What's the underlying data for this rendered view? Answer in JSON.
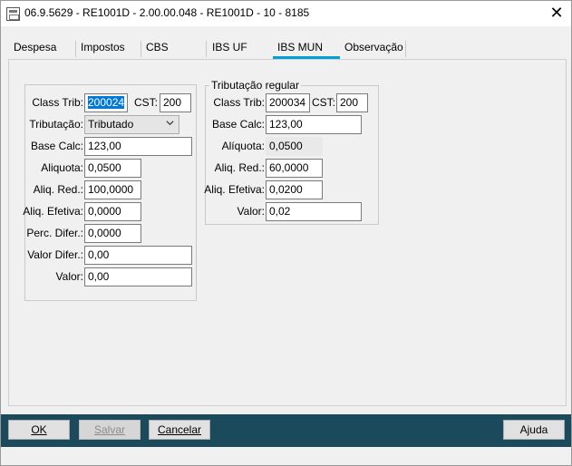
{
  "window": {
    "title": "06.9.5629 - RE1001D - 2.00.00.048 - RE1001D - 10 - 8185",
    "close_symbol": "✕"
  },
  "tabs": [
    {
      "label": "Despesa"
    },
    {
      "label": "Impostos"
    },
    {
      "label": "CBS"
    },
    {
      "label": "IBS UF"
    },
    {
      "label": "IBS MUN",
      "active": true
    },
    {
      "label": "Observação"
    }
  ],
  "left_group": {
    "class_trib_label": "Class Trib:",
    "class_trib_value": "200024",
    "cst_label": "CST:",
    "cst_value": "200",
    "tributacao_label": "Tributação:",
    "tributacao_value": "Tributado",
    "base_calc_label": "Base Calc:",
    "base_calc_value": "123,00",
    "aliquota_label": "Aliquota:",
    "aliquota_value": "0,0500",
    "aliq_red_label": "Aliq. Red.:",
    "aliq_red_value": "100,0000",
    "aliq_efetiva_label": "Aliq. Efetiva:",
    "aliq_efetiva_value": "0,0000",
    "perc_difer_label": "Perc. Difer.:",
    "perc_difer_value": "0,0000",
    "valor_difer_label": "Valor Difer.:",
    "valor_difer_value": "0,00",
    "valor_label": "Valor:",
    "valor_value": "0,00"
  },
  "right_group": {
    "legend": "Tributação regular",
    "class_trib_label": "Class Trib:",
    "class_trib_value": "200034",
    "cst_label": "CST:",
    "cst_value": "200",
    "base_calc_label": "Base Calc:",
    "base_calc_value": "123,00",
    "aliquota_label": "Alíquota:",
    "aliquota_value": "0,0500",
    "aliq_red_label": "Aliq. Red.:",
    "aliq_red_value": "60,0000",
    "aliq_efetiva_label": "Aliq. Efetiva:",
    "aliq_efetiva_value": "0,0200",
    "valor_label": "Valor:",
    "valor_value": "0,02"
  },
  "footer": {
    "ok_label": "OK",
    "salvar_label": "Salvar",
    "cancelar_label": "Cancelar",
    "ajuda_label": "Ajuda",
    "colors": {
      "bar": "#1b4a5c",
      "active_tab_underline": "#00a0d6"
    }
  }
}
